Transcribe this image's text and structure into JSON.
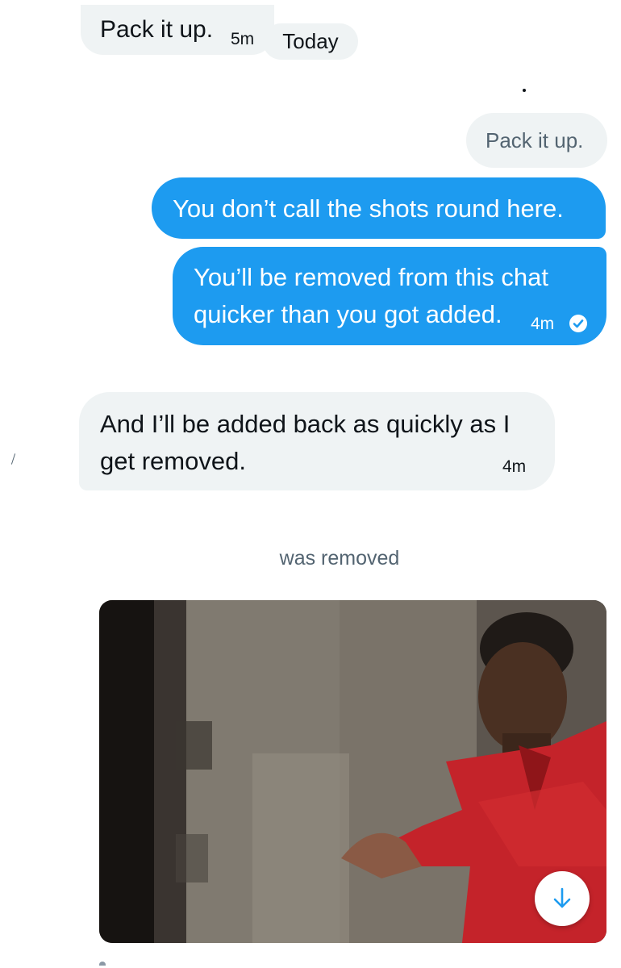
{
  "messages": {
    "m1": {
      "text": "Pack it up.",
      "time": "5m"
    },
    "date_divider": "Today",
    "m2": {
      "text": "Pack it up."
    },
    "m3": {
      "text": "You don’t call the shots round here."
    },
    "m4": {
      "line1": "You’ll be removed from this chat",
      "line2": "quicker than you got added.",
      "time": "4m",
      "status_icon": "read-check-icon"
    },
    "m5": {
      "line1": "And I’ll be added back as quickly as I",
      "line2": "get removed.",
      "time": "4m"
    }
  },
  "system_message": "was removed",
  "media": {
    "type": "gif",
    "subject": "man in red shirt gesturing"
  },
  "controls": {
    "scroll_down_icon": "arrow-down-icon"
  },
  "colors": {
    "outgoing": "#1d9bf0",
    "incoming": "#eff3f4",
    "muted_text": "#536471"
  }
}
